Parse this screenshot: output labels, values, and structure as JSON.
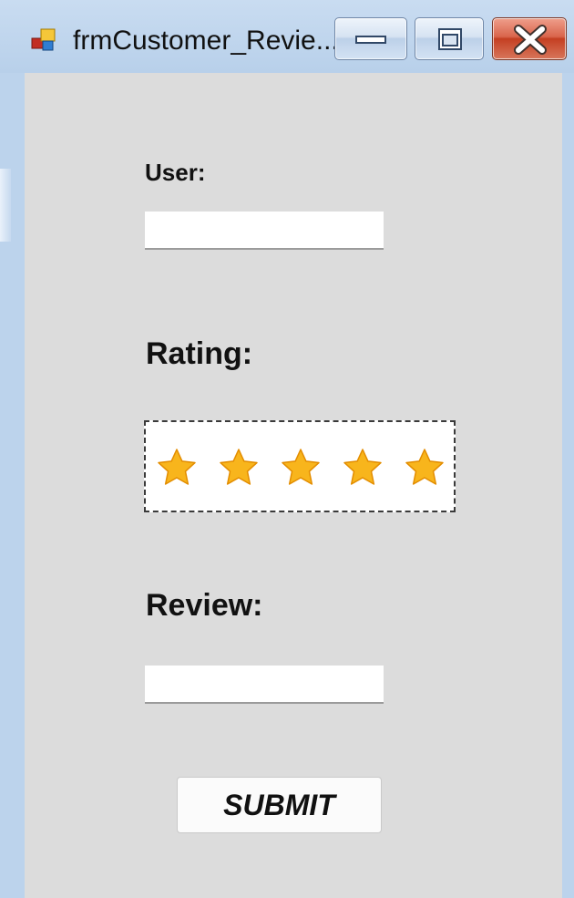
{
  "window": {
    "title": "frmCustomer_Revie..."
  },
  "form": {
    "user_label": "User:",
    "user_value": "",
    "rating_label": "Rating:",
    "rating": {
      "value": 5,
      "max": 5,
      "star_color": "#f8b51c",
      "star_stroke": "#e38d00"
    },
    "review_label": "Review:",
    "review_value": "",
    "submit_label": "SUBMIT"
  },
  "icons": {
    "app": "app-form-icon",
    "minimize": "minimize-icon",
    "maximize": "maximize-icon",
    "close": "close-icon",
    "star": "star-icon"
  }
}
